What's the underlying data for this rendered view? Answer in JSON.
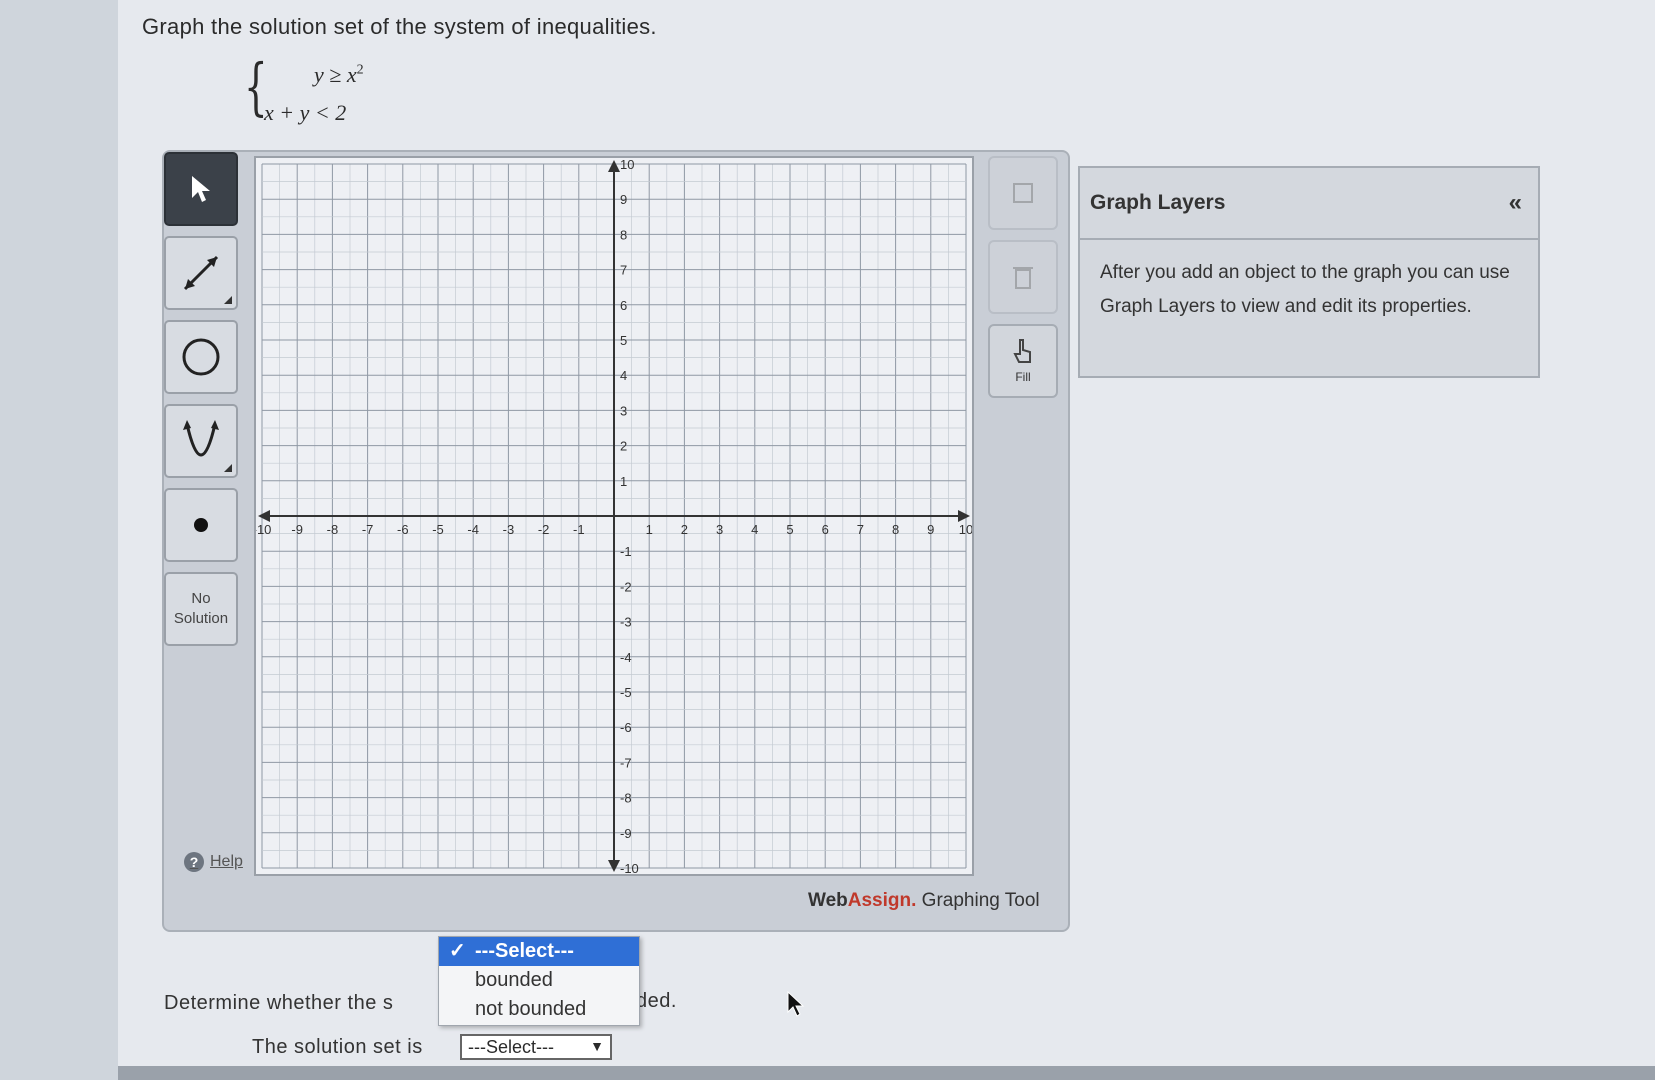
{
  "question": "Graph the solution set of the system of inequalities.",
  "system": {
    "line1_base": "y ≥ x",
    "line1_exp": "2",
    "line2": "x + y < 2"
  },
  "toolbar": {
    "tools": [
      {
        "name": "pointer-tool",
        "icon": "arrow-cursor-icon",
        "active": true
      },
      {
        "name": "line-tool",
        "icon": "line-segment-icon"
      },
      {
        "name": "circle-tool",
        "icon": "circle-icon"
      },
      {
        "name": "parabola-tool",
        "icon": "parabola-icon"
      },
      {
        "name": "point-tool",
        "icon": "point-icon"
      }
    ],
    "no_solution_line1": "No",
    "no_solution_line2": "Solution",
    "help_label": "Help"
  },
  "graph": {
    "x_range": [
      -10,
      10
    ],
    "y_range": [
      -10,
      10
    ],
    "grid": true,
    "x_ticks": [
      "-10",
      "-9",
      "-8",
      "-7",
      "-6",
      "-5",
      "-4",
      "-3",
      "-2",
      "-1",
      "1",
      "2",
      "3",
      "4",
      "5",
      "6",
      "7",
      "8",
      "9",
      "10"
    ],
    "y_ticks": [
      "10",
      "9",
      "8",
      "7",
      "6",
      "5",
      "4",
      "3",
      "2",
      "1",
      "-1",
      "-2",
      "-3",
      "-4",
      "-5",
      "-6",
      "-7",
      "-8",
      "-9",
      "-10"
    ]
  },
  "right_tools": {
    "fill_label": "Fill"
  },
  "brand": {
    "web": "Web",
    "assign": "Assign.",
    "suffix": " Graphing Tool"
  },
  "layers": {
    "title": "Graph Layers",
    "collapse": "«",
    "body": "After you add an object to the graph you can use Graph Layers to view and edit its properties."
  },
  "bounded": {
    "prompt_start": "Determine whether the s",
    "prompt_end": "ded.",
    "result_label": "The solution set is",
    "select_value": "---Select---",
    "options": [
      "---Select---",
      "bounded",
      "not bounded"
    ],
    "selected_index": 0
  },
  "colors": {
    "selected_option_bg": "#2f6fd6",
    "brand_accent": "#c0392b",
    "active_tool_bg": "#3b4149"
  }
}
